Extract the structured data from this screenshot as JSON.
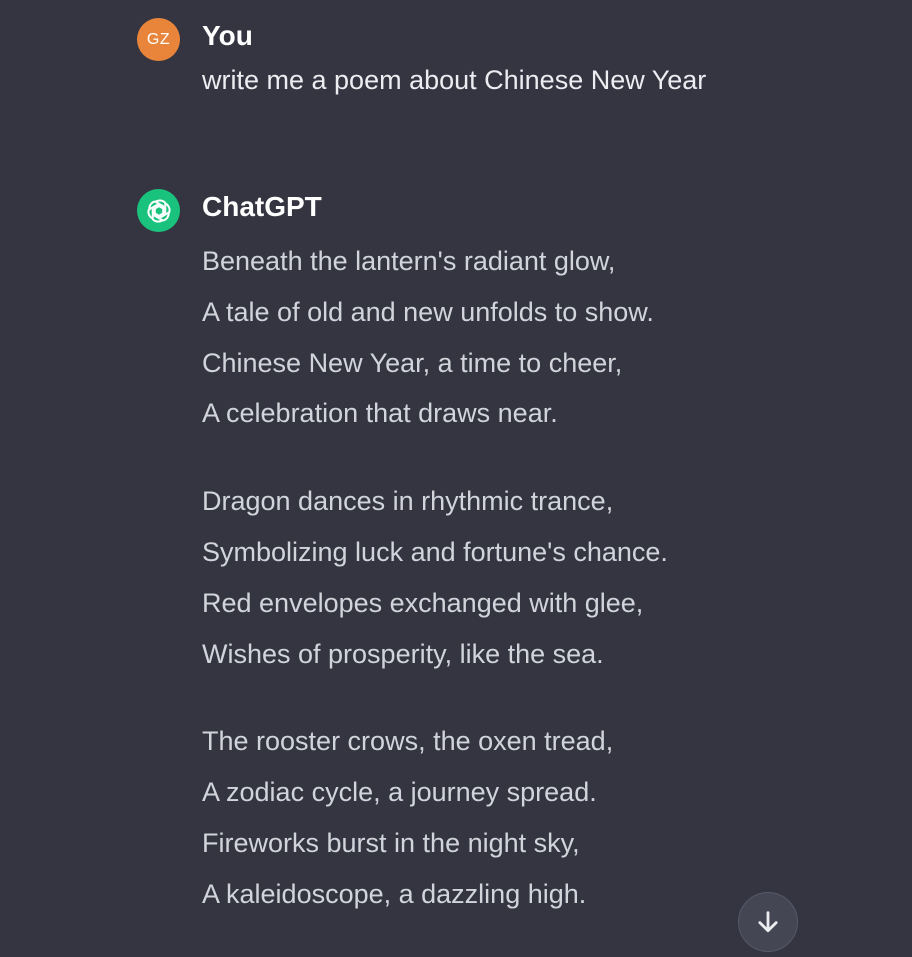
{
  "conversation": {
    "user": {
      "avatar_initials": "GZ",
      "avatar_color": "#e8853a",
      "author": "You",
      "message": "write me a poem about Chinese New Year"
    },
    "assistant": {
      "avatar_icon": "openai-logo-icon",
      "avatar_color": "#19c37d",
      "author": "ChatGPT",
      "stanzas": [
        [
          "Beneath the lantern's radiant glow,",
          "A tale of old and new unfolds to show.",
          "Chinese New Year, a time to cheer,",
          "A celebration that draws near."
        ],
        [
          "Dragon dances in rhythmic trance,",
          "Symbolizing luck and fortune's chance.",
          "Red envelopes exchanged with glee,",
          "Wishes of prosperity, like the sea."
        ],
        [
          "The rooster crows, the oxen tread,",
          "A zodiac cycle, a journey spread.",
          "Fireworks burst in the night sky,",
          "A kaleidoscope, a dazzling high."
        ]
      ]
    }
  },
  "controls": {
    "scroll_down_icon": "arrow-down-icon"
  },
  "colors": {
    "background": "#343541",
    "text": "#d1d5db",
    "scroll_button": "#444654"
  }
}
